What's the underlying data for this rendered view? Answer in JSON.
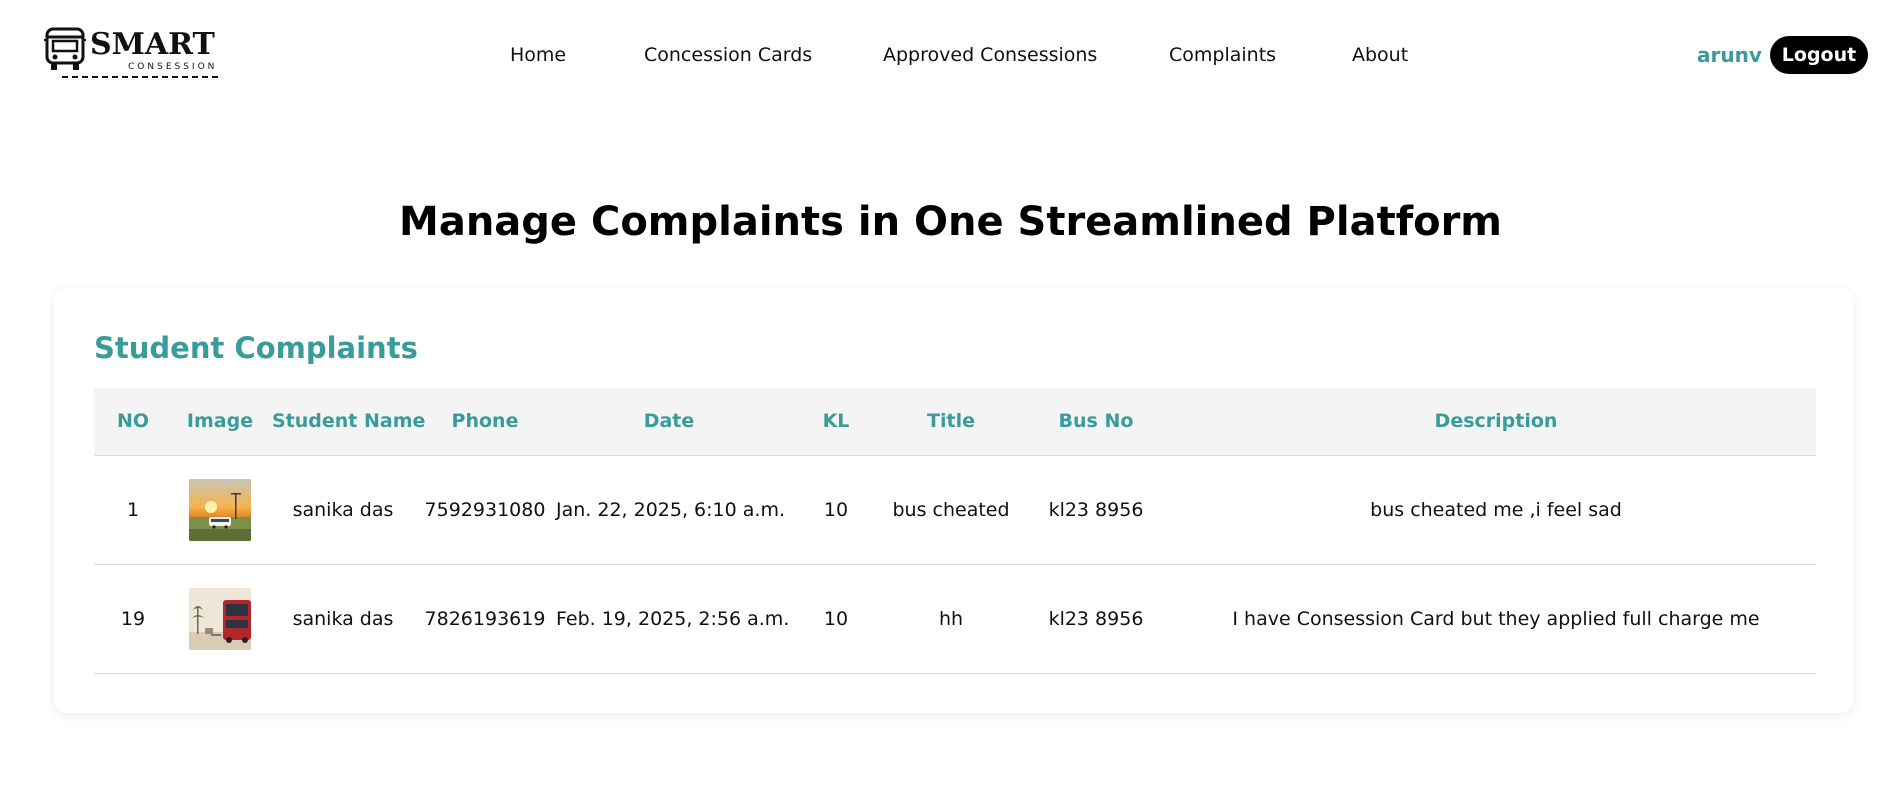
{
  "brand": {
    "name": "SMART",
    "tagline": "CONSESSION"
  },
  "nav": {
    "home": "Home",
    "concession_cards": "Concession Cards",
    "approved": "Approved Consessions",
    "complaints": "Complaints",
    "about": "About"
  },
  "user": {
    "name": "arunv",
    "logout_label": "Logout"
  },
  "page": {
    "heading": "Manage Complaints in One Streamlined Platform"
  },
  "complaints_card": {
    "title": "Student Complaints",
    "columns": [
      "NO",
      "Image",
      "Student Name",
      "Phone",
      "Date",
      "KL",
      "Title",
      "Bus No",
      "Description"
    ],
    "rows": [
      {
        "no": "1",
        "image_icon": "bus-sunset-photo",
        "student_name": "sanika das",
        "phone": "7592931080",
        "date": "Jan. 22, 2025, 6:10 a.m.",
        "kl": "10",
        "title": "bus cheated",
        "bus_no": "kl23 8956",
        "description": "bus cheated me ,i feel sad"
      },
      {
        "no": "19",
        "image_icon": "red-bus-street-photo",
        "student_name": "sanika das",
        "phone": "7826193619",
        "date": "Feb. 19, 2025, 2:56 a.m.",
        "kl": "10",
        "title": "hh",
        "bus_no": "kl23 8956",
        "description": "I have Consession Card but they applied full charge me"
      }
    ]
  },
  "colors": {
    "accent": "#3a9b9b",
    "button_bg": "#000000",
    "header_row_bg": "#f4f4f4"
  }
}
